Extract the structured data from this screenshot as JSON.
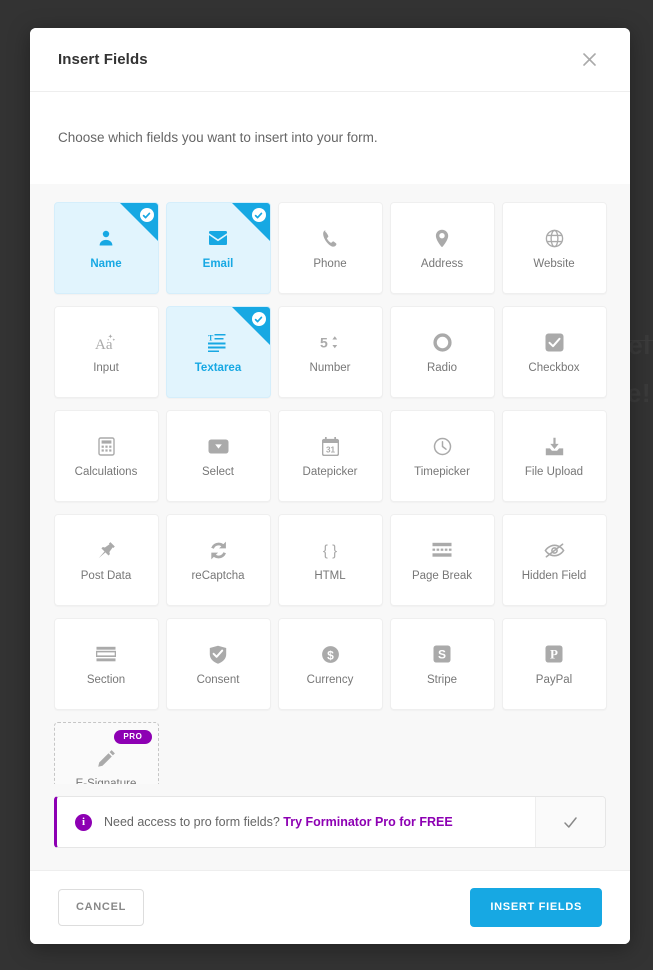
{
  "background": {
    "ghost_text_1": "vel",
    "ghost_text_2": "ove!"
  },
  "modal": {
    "title": "Insert Fields",
    "close_icon": "close-icon",
    "intro": "Choose which fields you want to insert into your form.",
    "fields": [
      {
        "label": "Name",
        "icon": "user-icon",
        "state": "selected"
      },
      {
        "label": "Email",
        "icon": "envelope-icon",
        "state": "selected"
      },
      {
        "label": "Phone",
        "icon": "phone-icon",
        "state": "default"
      },
      {
        "label": "Address",
        "icon": "map-pin-icon",
        "state": "default"
      },
      {
        "label": "Website",
        "icon": "globe-icon",
        "state": "default"
      },
      {
        "label": "Input",
        "icon": "text-aa-icon",
        "state": "default"
      },
      {
        "label": "Textarea",
        "icon": "textarea-icon",
        "state": "selected"
      },
      {
        "label": "Number",
        "icon": "number-icon",
        "state": "default"
      },
      {
        "label": "Radio",
        "icon": "radio-icon",
        "state": "default"
      },
      {
        "label": "Checkbox",
        "icon": "checkbox-icon",
        "state": "default"
      },
      {
        "label": "Calculations",
        "icon": "calculator-icon",
        "state": "default"
      },
      {
        "label": "Select",
        "icon": "dropdown-icon",
        "state": "default"
      },
      {
        "label": "Datepicker",
        "icon": "calendar-icon",
        "state": "default"
      },
      {
        "label": "Timepicker",
        "icon": "clock-icon",
        "state": "default"
      },
      {
        "label": "File Upload",
        "icon": "upload-icon",
        "state": "default"
      },
      {
        "label": "Post Data",
        "icon": "pin-icon",
        "state": "default"
      },
      {
        "label": "reCaptcha",
        "icon": "recaptcha-icon",
        "state": "default"
      },
      {
        "label": "HTML",
        "icon": "braces-icon",
        "state": "default"
      },
      {
        "label": "Page Break",
        "icon": "page-break-icon",
        "state": "default"
      },
      {
        "label": "Hidden Field",
        "icon": "eye-slash-icon",
        "state": "default"
      },
      {
        "label": "Section",
        "icon": "section-icon",
        "state": "default"
      },
      {
        "label": "Consent",
        "icon": "shield-check-icon",
        "state": "default"
      },
      {
        "label": "Currency",
        "icon": "dollar-icon",
        "state": "default"
      },
      {
        "label": "Stripe",
        "icon": "stripe-icon",
        "state": "default"
      },
      {
        "label": "PayPal",
        "icon": "paypal-icon",
        "state": "default"
      },
      {
        "label": "E-Signature",
        "icon": "pencil-icon",
        "state": "pro",
        "badge": "PRO"
      }
    ],
    "notice": {
      "icon": "info-icon",
      "text": "Need access to pro form fields?",
      "link_label": "Try Forminator Pro for FREE",
      "dismiss_icon": "check-icon"
    },
    "footer": {
      "cancel_label": "CANCEL",
      "submit_label": "INSERT FIELDS"
    }
  },
  "colors": {
    "accent_blue": "#17a8e3",
    "selected_bg": "#e1f4fd",
    "pro_purple": "#8d00b3",
    "overlay": "#333333",
    "body_bg": "#f8f8f8"
  }
}
